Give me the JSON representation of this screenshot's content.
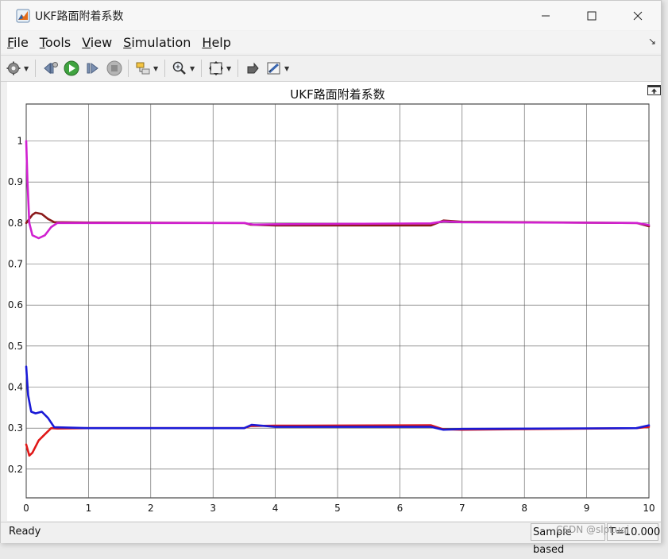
{
  "window": {
    "title": "UKF路面附着系数"
  },
  "menu": {
    "items": [
      {
        "label": "File",
        "ul": "F",
        "rest": "ile"
      },
      {
        "label": "Tools",
        "ul": "T",
        "rest": "ools"
      },
      {
        "label": "View",
        "ul": "V",
        "rest": "iew"
      },
      {
        "label": "Simulation",
        "ul": "S",
        "rest": "imulation"
      },
      {
        "label": "Help",
        "ul": "H",
        "rest": "elp"
      }
    ]
  },
  "toolbar": {
    "icons": [
      "gear-icon",
      "step-back-icon",
      "run-icon",
      "step-forward-icon",
      "stop-icon",
      "highlight-block-icon",
      "zoom-icon",
      "fit-view-icon",
      "restore-icon",
      "style-icon"
    ]
  },
  "status": {
    "left": "Ready",
    "mode": "Sample based",
    "time": "T=10.000"
  },
  "watermark": "CSDN @slpLuqi",
  "chart_data": {
    "type": "line",
    "title": "UKF路面附着系数",
    "xlabel": "",
    "ylabel": "",
    "xlim": [
      0,
      10
    ],
    "ylim": [
      0.13,
      1.09
    ],
    "xticks": [
      0,
      1,
      2,
      3,
      4,
      5,
      6,
      7,
      8,
      9,
      10
    ],
    "yticks": [
      0.2,
      0.3,
      0.4,
      0.5,
      0.6,
      0.7,
      0.8,
      0.9,
      1
    ],
    "grid": true,
    "series": [
      {
        "color": "#8b1a1a",
        "values": [
          [
            0,
            0.8
          ],
          [
            0.05,
            0.81
          ],
          [
            0.1,
            0.82
          ],
          [
            0.15,
            0.825
          ],
          [
            0.25,
            0.822
          ],
          [
            0.35,
            0.81
          ],
          [
            0.45,
            0.802
          ],
          [
            1,
            0.801
          ],
          [
            3.5,
            0.8
          ],
          [
            3.6,
            0.796
          ],
          [
            4,
            0.794
          ],
          [
            6.5,
            0.794
          ],
          [
            6.7,
            0.806
          ],
          [
            7,
            0.803
          ],
          [
            9.8,
            0.8
          ],
          [
            10,
            0.792
          ]
        ]
      },
      {
        "color": "#d020d0",
        "values": [
          [
            0,
            1.0
          ],
          [
            0.02,
            0.9
          ],
          [
            0.05,
            0.8
          ],
          [
            0.1,
            0.77
          ],
          [
            0.2,
            0.763
          ],
          [
            0.3,
            0.77
          ],
          [
            0.4,
            0.79
          ],
          [
            0.5,
            0.8
          ],
          [
            1,
            0.8
          ],
          [
            3.5,
            0.8
          ],
          [
            3.65,
            0.796
          ],
          [
            4,
            0.797
          ],
          [
            6.5,
            0.799
          ],
          [
            6.7,
            0.804
          ],
          [
            7,
            0.802
          ],
          [
            9.8,
            0.8
          ],
          [
            10,
            0.795
          ]
        ]
      },
      {
        "color": "#e01818",
        "values": [
          [
            0,
            0.26
          ],
          [
            0.05,
            0.233
          ],
          [
            0.1,
            0.24
          ],
          [
            0.2,
            0.27
          ],
          [
            0.3,
            0.285
          ],
          [
            0.4,
            0.3
          ],
          [
            0.5,
            0.299
          ],
          [
            1,
            0.3
          ],
          [
            3.5,
            0.3
          ],
          [
            3.6,
            0.305
          ],
          [
            4,
            0.306
          ],
          [
            6.5,
            0.307
          ],
          [
            6.7,
            0.297
          ],
          [
            7,
            0.296
          ],
          [
            9.8,
            0.3
          ],
          [
            10,
            0.303
          ]
        ]
      },
      {
        "color": "#1a1ad6",
        "values": [
          [
            0,
            0.45
          ],
          [
            0.03,
            0.38
          ],
          [
            0.08,
            0.34
          ],
          [
            0.15,
            0.336
          ],
          [
            0.25,
            0.34
          ],
          [
            0.35,
            0.325
          ],
          [
            0.45,
            0.302
          ],
          [
            1,
            0.3
          ],
          [
            3.5,
            0.3
          ],
          [
            3.62,
            0.308
          ],
          [
            4,
            0.303
          ],
          [
            6.5,
            0.303
          ],
          [
            6.7,
            0.296
          ],
          [
            7,
            0.298
          ],
          [
            9.8,
            0.3
          ],
          [
            10,
            0.307
          ]
        ]
      }
    ]
  }
}
